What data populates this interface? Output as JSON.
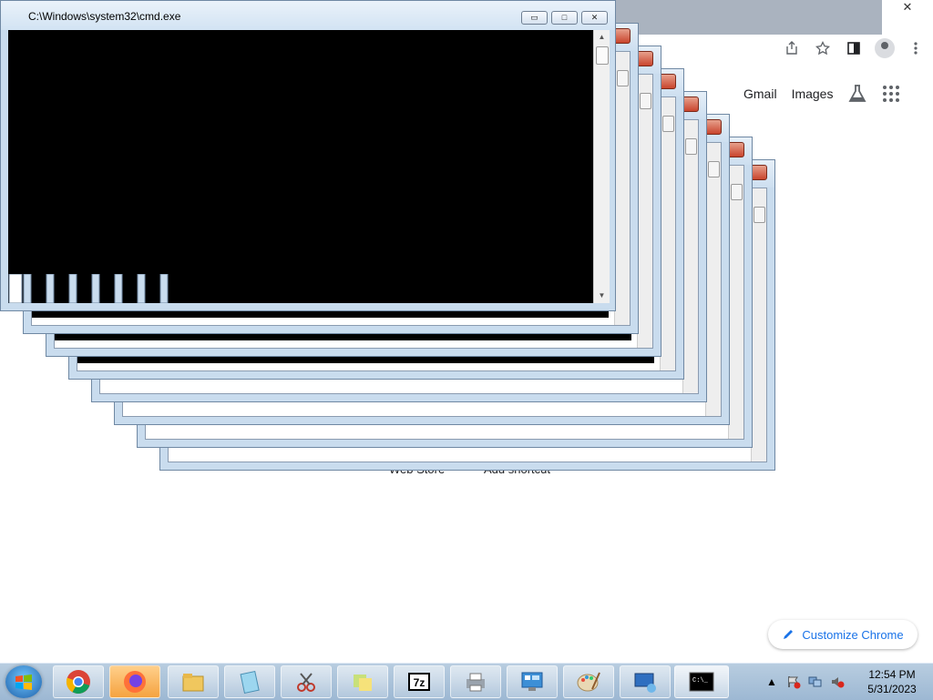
{
  "cmd_window": {
    "title": "C:\\Windows\\system32\\cmd.exe",
    "min_glyph": "▭",
    "max_glyph": "□",
    "close_glyph": "✕"
  },
  "chrome": {
    "close_glyph": "✕",
    "links": {
      "gmail": "Gmail",
      "images": "Images"
    },
    "shortcuts": {
      "web_store": "Web Store",
      "add_shortcut": "Add shortcut"
    },
    "customize_label": "Customize Chrome"
  },
  "taskbar": {
    "apps": [
      "chrome-icon",
      "firefox-icon",
      "file-explorer-icon",
      "notepad-icon",
      "snipping-tool-icon",
      "sticky-notes-icon",
      "7zip-icon",
      "printer-icon",
      "control-panel-icon",
      "paint-icon",
      "remote-desktop-icon",
      "cmd-icon"
    ],
    "clock": {
      "time": "12:54 PM",
      "date": "5/31/2023"
    }
  },
  "colors": {
    "accent": "#1a73e8",
    "window_frame": "#c9dcee",
    "window_close": "#c9452d",
    "taskbar": "#9db8d3"
  }
}
